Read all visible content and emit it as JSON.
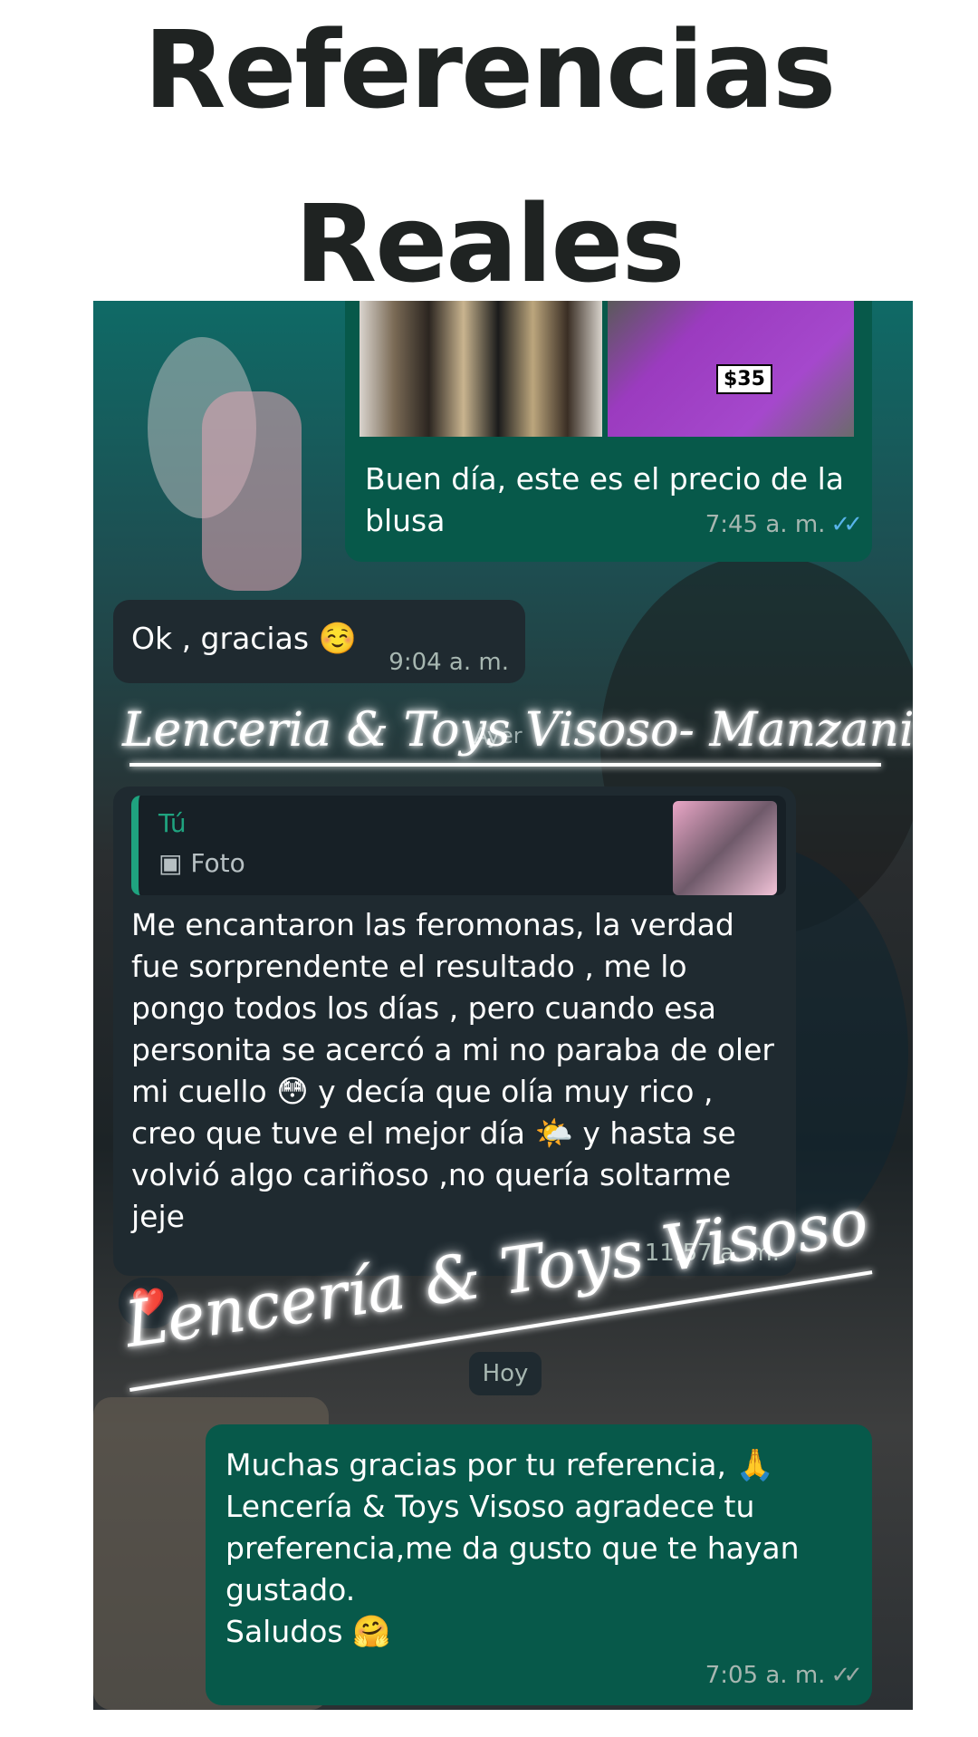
{
  "page": {
    "title_line1": "Referencias",
    "title_line2": "Reales"
  },
  "chat": {
    "msg1": {
      "price_tag": "$35",
      "text": "Buen día, este es el precio de la blusa",
      "time": "7:45 a. m."
    },
    "msg2": {
      "text": "Ok , gracias",
      "emoji": "☺️",
      "time": "9:04 a. m."
    },
    "date_divider_partial": "Ayer",
    "watermark1": "Lenceria & Toys Visoso- Manzanillo",
    "msg3": {
      "quote_author": "Tú",
      "quote_type": "Foto",
      "text_a": "Me encantaron las feromonas, la verdad fue sorprendente el resultado , me lo pongo todos los días , pero cuando esa personita se acercó a mi no paraba de oler mi cuello",
      "emoji_a": "😳",
      "text_b": "y decía que olía muy rico ,  creo que tuve el mejor día",
      "emoji_b": "🌤️",
      "text_c": "y hasta se volvió algo cariñoso ,no quería soltarme jeje",
      "time": "11:57 a. m.",
      "reaction": "❤️"
    },
    "watermark2": "Lencería & Toys Visoso",
    "date_divider": "Hoy",
    "msg4": {
      "text_a": "Muchas gracias por tu referencia,",
      "emoji_a": "🙏",
      "text_b": "Lencería & Toys Visoso agradece tu preferencia,me da gusto que te hayan gustado.",
      "text_c": "Saludos",
      "emoji_c": "🤗",
      "time": "7:05 a. m."
    }
  },
  "colors": {
    "outgoing_bubble": "#07594a",
    "incoming_bubble": "#1f2a30",
    "read_ticks": "#58b4ea",
    "title": "#1f2322"
  }
}
